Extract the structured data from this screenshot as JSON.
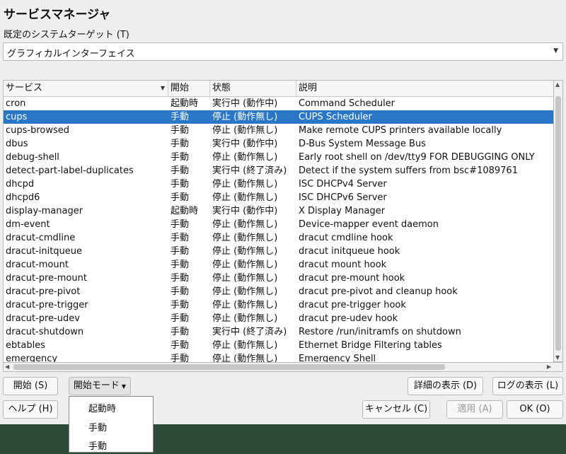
{
  "window": {
    "title": "サービスマネージャ"
  },
  "target": {
    "label": "既定のシステムターゲット (T)",
    "value": "グラフィカルインターフェイス"
  },
  "table": {
    "headers": [
      "サービス",
      "開始",
      "状態",
      "説明"
    ],
    "rows": [
      [
        "cron",
        "起動時",
        "実行中 (動作中)",
        "Command Scheduler"
      ],
      [
        "cups",
        "手動",
        "停止 (動作無し)",
        "CUPS Scheduler"
      ],
      [
        "cups-browsed",
        "手動",
        "停止 (動作無し)",
        "Make remote CUPS printers available locally"
      ],
      [
        "dbus",
        "手動",
        "実行中 (動作中)",
        "D-Bus System Message Bus"
      ],
      [
        "debug-shell",
        "手動",
        "停止 (動作無し)",
        "Early root shell on /dev/tty9 FOR DEBUGGING ONLY"
      ],
      [
        "detect-part-label-duplicates",
        "手動",
        "実行中 (終了済み)",
        "Detect if the system suffers from bsc#1089761"
      ],
      [
        "dhcpd",
        "手動",
        "停止 (動作無し)",
        "ISC DHCPv4 Server"
      ],
      [
        "dhcpd6",
        "手動",
        "停止 (動作無し)",
        "ISC DHCPv6 Server"
      ],
      [
        "display-manager",
        "起動時",
        "実行中 (動作中)",
        "X Display Manager"
      ],
      [
        "dm-event",
        "手動",
        "停止 (動作無し)",
        "Device-mapper event daemon"
      ],
      [
        "dracut-cmdline",
        "手動",
        "停止 (動作無し)",
        "dracut cmdline hook"
      ],
      [
        "dracut-initqueue",
        "手動",
        "停止 (動作無し)",
        "dracut initqueue hook"
      ],
      [
        "dracut-mount",
        "手動",
        "停止 (動作無し)",
        "dracut mount hook"
      ],
      [
        "dracut-pre-mount",
        "手動",
        "停止 (動作無し)",
        "dracut pre-mount hook"
      ],
      [
        "dracut-pre-pivot",
        "手動",
        "停止 (動作無し)",
        "dracut pre-pivot and cleanup hook"
      ],
      [
        "dracut-pre-trigger",
        "手動",
        "停止 (動作無し)",
        "dracut pre-trigger hook"
      ],
      [
        "dracut-pre-udev",
        "手動",
        "停止 (動作無し)",
        "dracut pre-udev hook"
      ],
      [
        "dracut-shutdown",
        "手動",
        "実行中 (終了済み)",
        "Restore /run/initramfs on shutdown"
      ],
      [
        "ebtables",
        "手動",
        "停止 (動作無し)",
        "Ethernet Bridge Filtering tables"
      ],
      [
        "emergency",
        "手動",
        "停止 (動作無し)",
        "Emergency Shell"
      ]
    ]
  },
  "buttons": {
    "start": "開始 (S)",
    "start_mode": "開始モード",
    "details": "詳細の表示 (D)",
    "log": "ログの表示 (L)",
    "help": "ヘルプ (H)",
    "cancel": "キャンセル (C)",
    "apply": "適用 (A)",
    "ok": "OK (O)"
  },
  "start_mode_menu": [
    "起動時",
    "手動",
    "手動"
  ]
}
